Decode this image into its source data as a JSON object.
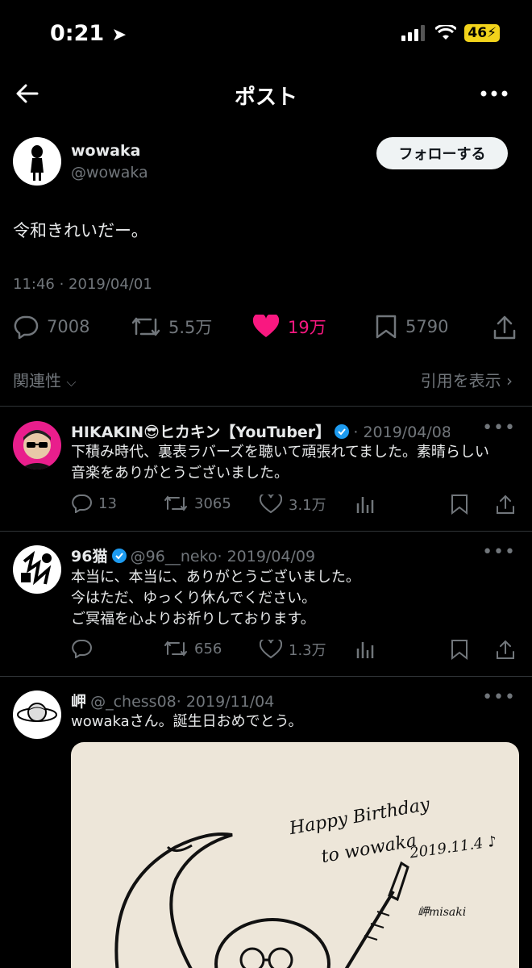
{
  "status_bar": {
    "time": "0:21",
    "battery": "46"
  },
  "header": {
    "title": "ポスト"
  },
  "post": {
    "display_name": "wowaka",
    "handle": "@wowaka",
    "follow_label": "フォローする",
    "text": "令和きれいだー。",
    "timestamp": "11:46 · 2019/04/01",
    "stats": {
      "replies": "7008",
      "reposts": "5.5万",
      "likes": "19万",
      "bookmarks": "5790"
    }
  },
  "colors": {
    "like_active": "#f91880",
    "verified": "#1d9bf0",
    "muted": "#71767b"
  },
  "sort": {
    "label": "関連性",
    "quotes_link": "引用を表示"
  },
  "replies": [
    {
      "name": "HIKAKIN😎ヒカキン【YouTuber】",
      "handle": "",
      "date": "· 2019/04/08",
      "lines": [
        "下積み時代、裏表ラバーズを聴いて頑張れてました。素晴らしい",
        "音楽をありがとうございました。"
      ],
      "replies": "13",
      "reposts": "3065",
      "likes": "3.1万"
    },
    {
      "name": "96猫",
      "handle": "@96__neko",
      "date": "· 2019/04/09",
      "lines": [
        "本当に、本当に、ありがとうございました。",
        "今はただ、ゆっくり休んでください。",
        "ご冥福を心よりお祈りしております。"
      ],
      "replies": "",
      "reposts": "656",
      "likes": "1.3万"
    },
    {
      "name": "岬",
      "handle": "@_chess08",
      "date": "· 2019/11/04",
      "lines": [
        "wowakaさん。誕生日おめでとう。"
      ],
      "image_lines": [
        "Happy Birthday",
        "to wowaka",
        "2019.11.4 ♪",
        "岬misaki"
      ]
    }
  ]
}
